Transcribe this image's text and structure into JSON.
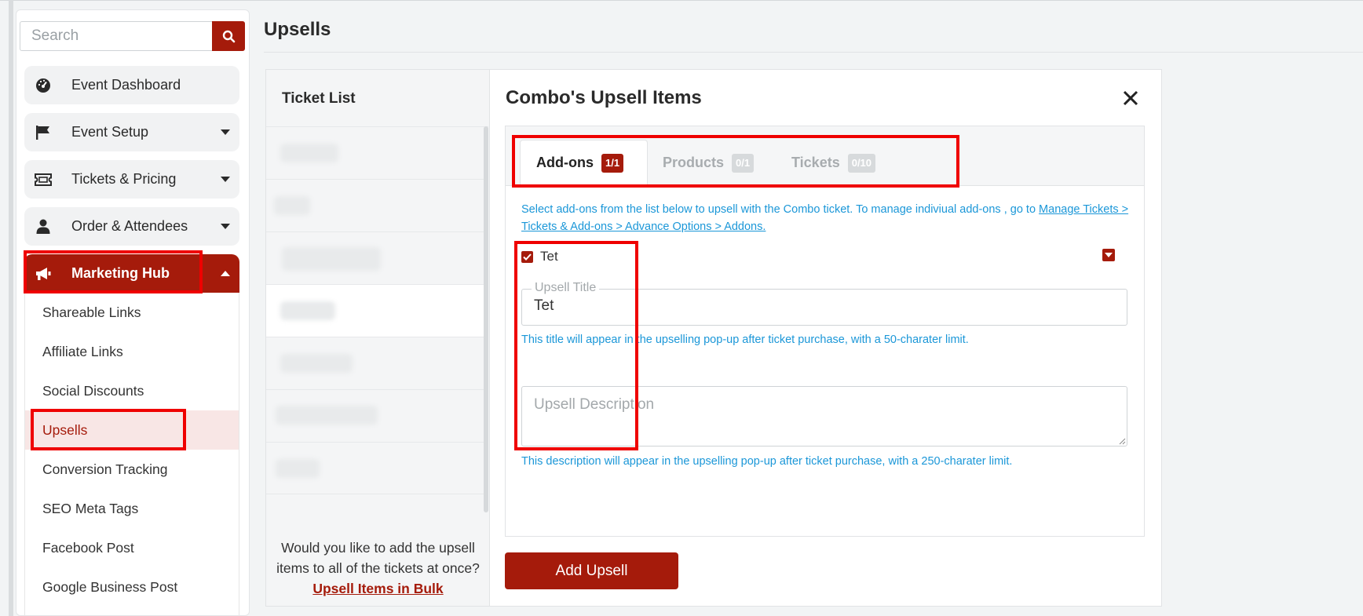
{
  "search": {
    "placeholder": "Search"
  },
  "sidebar": {
    "items": [
      {
        "label": "Event Dashboard",
        "icon": "dashboard-icon"
      },
      {
        "label": "Event Setup",
        "icon": "flag-icon"
      },
      {
        "label": "Tickets & Pricing",
        "icon": "ticket-icon"
      },
      {
        "label": "Order & Attendees",
        "icon": "user-icon"
      },
      {
        "label": "Marketing Hub",
        "icon": "megaphone-icon"
      }
    ],
    "submenu": [
      "Shareable Links",
      "Affiliate Links",
      "Social Discounts",
      "Upsells",
      "Conversion Tracking",
      "SEO Meta Tags",
      "Facebook Post",
      "Google Business Post"
    ],
    "selected_submenu": "Upsells"
  },
  "page": {
    "title": "Upsells"
  },
  "ticket_list": {
    "heading": "Ticket List",
    "bulk_text": "Would you like to add the upsell items to all of the tickets at once?",
    "bulk_link": "Upsell Items in Bulk"
  },
  "modal": {
    "title": "Combo's Upsell Items",
    "tabs": [
      {
        "label": "Add-ons",
        "badge": "1/1"
      },
      {
        "label": "Products",
        "badge": "0/1"
      },
      {
        "label": "Tickets",
        "badge": "0/10"
      }
    ],
    "info_text": "Select add-ons from the list below to upsell with the Combo ticket. To manage indiviual add-ons , go to ",
    "info_link": "Manage Tickets > Tickets & Add-ons > Advance Options > Addons.",
    "addon_name": "Tet",
    "upsell_title_label": "Upsell Title",
    "upsell_title_value": "Tet",
    "title_help": "This title will appear in the upselling pop-up after ticket purchase, with a 50-charater limit.",
    "description_placeholder": "Upsell Description",
    "description_help": "This description will appear in the upselling pop-up after ticket purchase, with a 250-charater limit.",
    "add_button": "Add Upsell"
  },
  "colors": {
    "brand": "#a51b0b",
    "info": "#1b97d8",
    "highlight": "#ef0000"
  }
}
